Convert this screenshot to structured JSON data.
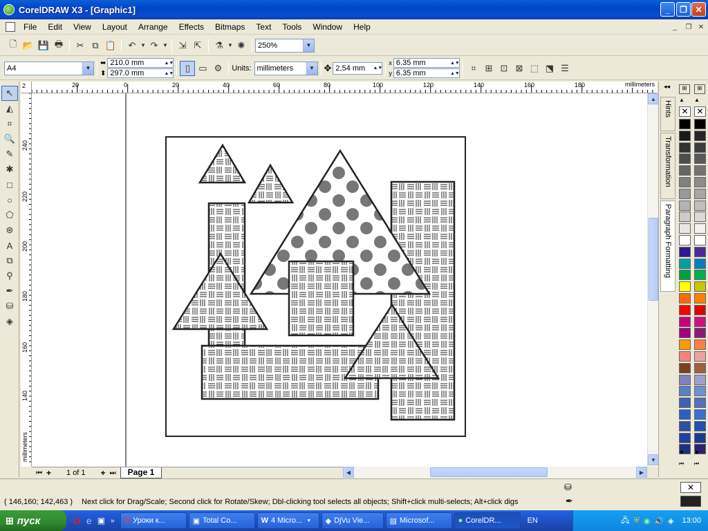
{
  "window": {
    "title": "CorelDRAW X3 - [Graphic1]"
  },
  "menu": [
    "File",
    "Edit",
    "View",
    "Layout",
    "Arrange",
    "Effects",
    "Bitmaps",
    "Text",
    "Tools",
    "Window",
    "Help"
  ],
  "toolbar": {
    "zoom": "250%"
  },
  "propertybar": {
    "paper": "A4",
    "width": "210.0 mm",
    "height": "297.0 mm",
    "units_label": "Units:",
    "units": "millimeters",
    "nudge": "2,54 mm",
    "dup_x": "6.35 mm",
    "dup_y": "6.35 mm"
  },
  "ruler": {
    "h_labels": [
      "20",
      "0",
      "20",
      "40",
      "60",
      "80",
      "100",
      "120",
      "140",
      "160",
      "180"
    ],
    "h_units": "millimeters",
    "v_labels": [
      "240",
      "220",
      "200",
      "180",
      "160",
      "140"
    ],
    "v_units": "millimeters",
    "corner": "2"
  },
  "dockers": {
    "hints": "Hints",
    "transformation": "Transformation",
    "paragraph": "Paragraph Formatting"
  },
  "pagenav": {
    "count": "1 of 1",
    "page_tab": "Page 1"
  },
  "status": {
    "coords": "( 146,160; 142,463 )",
    "message": "Next click for Drag/Scale; Second click for Rotate/Skew; Dbl-clicking tool selects all objects; Shift+click multi-selects; Alt+click digs"
  },
  "taskbar": {
    "start": "пуск",
    "tasks": [
      "Уроки к...",
      "Total Co...",
      "4 Micro...",
      "DjVu Vie...",
      "Microsof...",
      "CorelDR..."
    ],
    "lang": "EN",
    "clock": "13:00"
  },
  "palette": {
    "colors_left": [
      "#000000",
      "#1a1a1a",
      "#333333",
      "#4d4d4d",
      "#666666",
      "#808080",
      "#999999",
      "#b3b3b3",
      "#cccccc",
      "#e6e6e6",
      "#ffffff",
      "#2d1a8c",
      "#00a0a0",
      "#00a040",
      "#ffff00",
      "#ff6a00",
      "#ff0000",
      "#c8007a",
      "#a0007a",
      "#ff9a00",
      "#ff8080",
      "#7a4020",
      "#8080c0",
      "#5a80c0",
      "#4060b0",
      "#2a60c0",
      "#3050a0",
      "#2040a0",
      "#203080"
    ],
    "colors_right": [
      "#000000",
      "#262626",
      "#3d3d3d",
      "#595959",
      "#737373",
      "#8c8c8c",
      "#a6a6a6",
      "#bfbfbf",
      "#d9d9d9",
      "#f2f2f2",
      "#ffffff",
      "#4a2a9a",
      "#0080c0",
      "#00b050",
      "#c8c800",
      "#ff8000",
      "#e00000",
      "#d01080",
      "#8a1a7a",
      "#ff8040",
      "#f0a0a0",
      "#a06040",
      "#a0a0d0",
      "#7090d0",
      "#5070c0",
      "#3a70d0",
      "#2050b0",
      "#1a3a90",
      "#302070"
    ]
  }
}
